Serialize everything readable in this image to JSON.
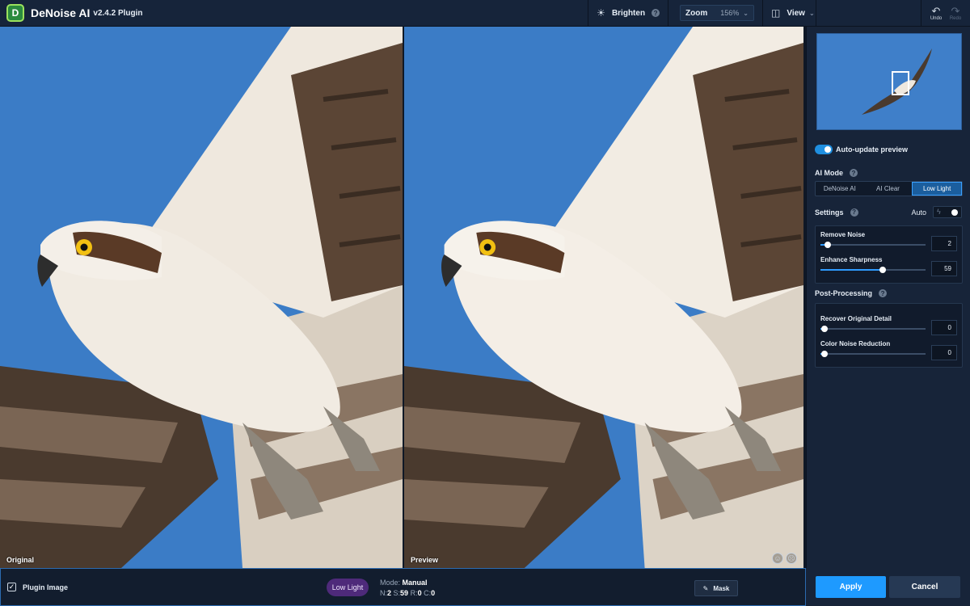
{
  "app": {
    "title": "DeNoise AI",
    "version": "v2.4.2 Plugin",
    "logo_letter": "D"
  },
  "toolbar": {
    "brighten_label": "Brighten",
    "zoom_label": "Zoom",
    "zoom_value": "156%",
    "view_label": "View",
    "undo_label": "Undo",
    "redo_label": "Redo"
  },
  "panes": {
    "left_label": "Original",
    "right_label": "Preview"
  },
  "panel": {
    "auto_update_label": "Auto-update preview",
    "ai_mode_label": "AI Mode",
    "ai_modes": [
      "DeNoise AI",
      "AI Clear",
      "Low Light"
    ],
    "ai_mode_selected": "Low Light",
    "settings_label": "Settings",
    "auto_label": "Auto",
    "settings": [
      {
        "label": "Remove Noise",
        "value": 2,
        "fraction": 0.07
      },
      {
        "label": "Enhance Sharpness",
        "value": 59,
        "fraction": 0.59
      }
    ],
    "post_label": "Post-Processing",
    "post": [
      {
        "label": "Recover Original Detail",
        "value": 0,
        "fraction": 0.04
      },
      {
        "label": "Color Noise Reduction",
        "value": 0,
        "fraction": 0.04
      }
    ]
  },
  "bottom": {
    "plugin_label": "Plugin Image",
    "mode_pill": "Low Light",
    "mode_prefix": "Mode:",
    "mode_value": "Manual",
    "stats": [
      {
        "k": "N:",
        "v": "2"
      },
      {
        "k": "S:",
        "v": "59"
      },
      {
        "k": "R:",
        "v": "0"
      },
      {
        "k": "C:",
        "v": "0"
      }
    ],
    "mask_label": "Mask",
    "apply_label": "Apply",
    "cancel_label": "Cancel"
  },
  "colors": {
    "accent": "#1e9aff",
    "sky": "#3f7fc9",
    "pill": "#4e2a7a"
  }
}
